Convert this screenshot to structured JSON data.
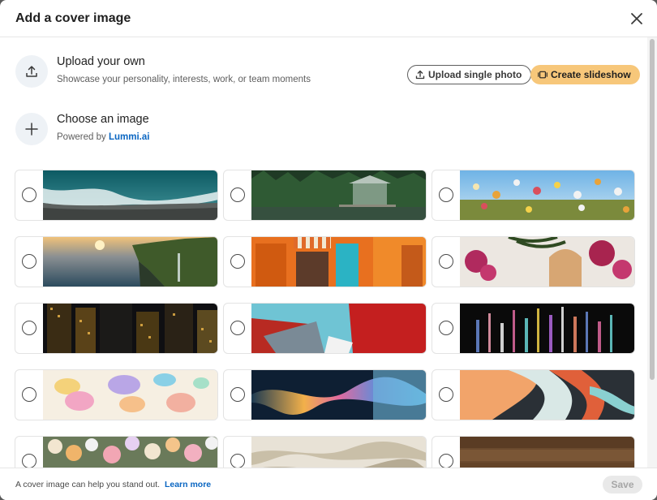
{
  "modal": {
    "title": "Add a cover image"
  },
  "upload_option": {
    "icon": "upload-icon",
    "title": "Upload your own",
    "subtitle": "Showcase your personality, interests, work, or team moments",
    "upload_button": "Upload single photo",
    "slideshow_button": "Create slideshow",
    "slideshow_color": "#f7c77a"
  },
  "choose_option": {
    "icon": "plus-icon",
    "title": "Choose an image",
    "powered_by": "Powered by",
    "brand": "Lummi.ai",
    "brand_color": "#0a66c2"
  },
  "images": [
    {
      "name": "ocean-waves-beach"
    },
    {
      "name": "forest-lake-cabin"
    },
    {
      "name": "wildflower-meadow"
    },
    {
      "name": "coastal-cliffs-sunset"
    },
    {
      "name": "orange-storefront"
    },
    {
      "name": "palm-bougainvillea-wall"
    },
    {
      "name": "city-night-skyscrapers"
    },
    {
      "name": "red-teal-abstract-geometry"
    },
    {
      "name": "color-light-streaks"
    },
    {
      "name": "pastel-blobs"
    },
    {
      "name": "rainbow-reflection"
    },
    {
      "name": "marbled-paint-swirl"
    },
    {
      "name": "flowers-bouquet"
    },
    {
      "name": "marble-stone-texture"
    },
    {
      "name": "wood-planks"
    }
  ],
  "footer": {
    "text": "A cover image can help you stand out.",
    "link": "Learn more",
    "save": "Save"
  }
}
